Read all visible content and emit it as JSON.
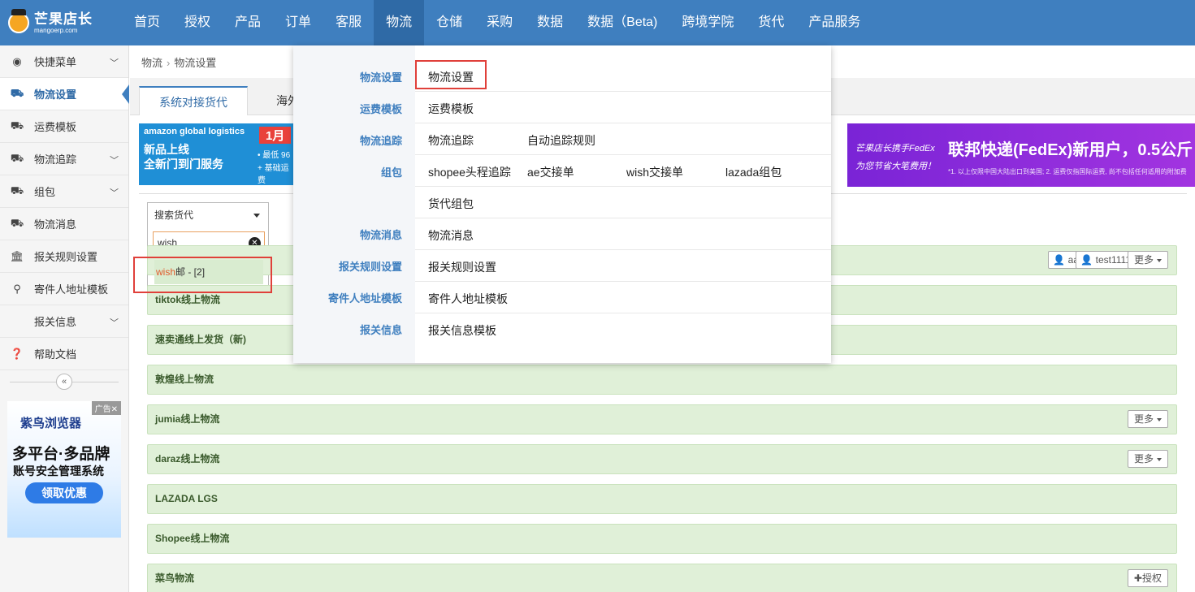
{
  "logo": {
    "name": "芒果店长",
    "domain": "mangoerp.com"
  },
  "nav": [
    "首页",
    "授权",
    "产品",
    "订单",
    "客服",
    "物流",
    "仓储",
    "采购",
    "数据",
    "数据（Beta)",
    "跨境学院",
    "货代",
    "产品服务"
  ],
  "nav_active": "物流",
  "sidebar": {
    "items": [
      {
        "label": "快捷菜单",
        "icon": "dashboard-icon",
        "chevron": true
      },
      {
        "label": "物流设置",
        "icon": "truck-icon",
        "active": true
      },
      {
        "label": "运费模板",
        "icon": "truck-icon"
      },
      {
        "label": "物流追踪",
        "icon": "truck-icon",
        "chevron": true
      },
      {
        "label": "组包",
        "icon": "truck-icon",
        "chevron": true
      },
      {
        "label": "物流消息",
        "icon": "truck-icon"
      },
      {
        "label": "报关规则设置",
        "icon": "bank-icon"
      },
      {
        "label": "寄件人地址模板",
        "icon": "map-marker-icon"
      },
      {
        "label": "报关信息",
        "icon": "",
        "chevron": true
      },
      {
        "label": "帮助文档",
        "icon": "question-circle-icon"
      }
    ],
    "collapse_glyph": "«",
    "ad": {
      "tag": "广告✕",
      "brand": "紫鸟浏览器",
      "line1": "多平台·多品牌",
      "line2": "账号安全管理系统",
      "button": "领取优惠"
    }
  },
  "breadcrumb": [
    "物流",
    "物流设置"
  ],
  "tabs": [
    "系统对接货代",
    "海外仓"
  ],
  "banner_amazon": {
    "brand": "amazon global logistics",
    "line1": "新品上线",
    "line2": "全新门到门服务",
    "badge": "1月",
    "note1": "• 最低 96",
    "note2": "+ 基础运费"
  },
  "banner_fedex": {
    "line1": "芒果店长携手FedEx",
    "line2": "为您节省大笔费用！",
    "headline": "联邦快递(FedEx)新用户，0.5公斤",
    "fine": "*1. 以上仅限中国大陆出口到美国; 2. 运费仅指国际运费, 尚不包括任何适用的附加费"
  },
  "search": {
    "select_label": "搜索货代",
    "input_value": "wish",
    "result_highlight": "wish",
    "result_rest": "邮 - [2]"
  },
  "rows": [
    {
      "label": "",
      "users": [
        "aa",
        "test1111"
      ],
      "more": "更多"
    },
    {
      "label": "tiktok线上物流"
    },
    {
      "label": "速卖通线上发货（新)"
    },
    {
      "label": "敦煌线上物流"
    },
    {
      "label": "jumia线上物流",
      "more": "更多"
    },
    {
      "label": "daraz线上物流",
      "more": "更多"
    },
    {
      "label": "LAZADA LGS"
    },
    {
      "label": "Shopee线上物流"
    },
    {
      "label": "菜鸟物流",
      "auth": "授权"
    }
  ],
  "mega_menu": {
    "categories": [
      "物流设置",
      "运费模板",
      "物流追踪",
      "组包",
      "物流消息",
      "报关规则设置",
      "寄件人地址模板",
      "报关信息"
    ],
    "rows": [
      [
        "物流设置"
      ],
      [
        "运费模板"
      ],
      [
        "物流追踪",
        "自动追踪规则"
      ],
      [
        "shopee头程追踪",
        "ae交接单",
        "wish交接单",
        "lazada组包"
      ],
      [
        "货代组包"
      ],
      [
        "物流消息"
      ],
      [
        "报关规则设置"
      ],
      [
        "寄件人地址模板"
      ],
      [
        "报关信息模板"
      ]
    ]
  },
  "colors": {
    "nav_bg": "#3f7fbf",
    "nav_active": "#2f6aa6",
    "highlight_box": "#e0403a",
    "row_bg": "#e0f0d8"
  }
}
